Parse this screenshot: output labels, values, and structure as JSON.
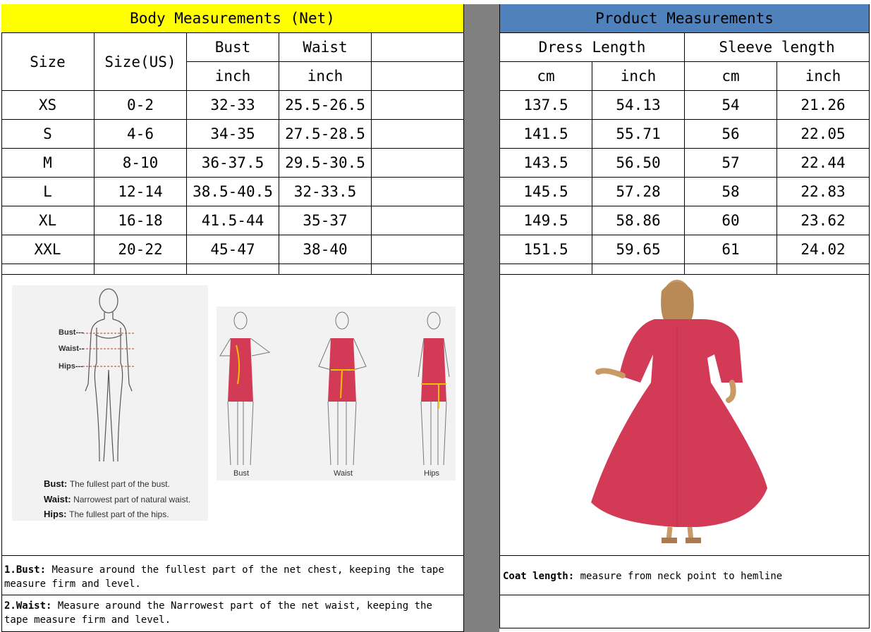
{
  "body_table": {
    "title": "Body Measurements (Net)",
    "col_size": "Size",
    "col_size_us": "Size(US)",
    "col_bust": "Bust",
    "col_waist": "Waist",
    "unit_bust": "inch",
    "unit_waist": "inch",
    "rows": [
      {
        "size": "XS",
        "us": "0-2",
        "bust": "32-33",
        "waist": "25.5-26.5"
      },
      {
        "size": "S",
        "us": "4-6",
        "bust": "34-35",
        "waist": "27.5-28.5"
      },
      {
        "size": "M",
        "us": "8-10",
        "bust": "36-37.5",
        "waist": "29.5-30.5"
      },
      {
        "size": "L",
        "us": "12-14",
        "bust": "38.5-40.5",
        "waist": "32-33.5"
      },
      {
        "size": "XL",
        "us": "16-18",
        "bust": "41.5-44",
        "waist": "35-37"
      },
      {
        "size": "XXL",
        "us": "20-22",
        "bust": "45-47",
        "waist": "38-40"
      }
    ]
  },
  "product_table": {
    "title": "Product Measurements",
    "col_dress_length": "Dress Length",
    "col_sleeve_length": "Sleeve length",
    "units": [
      "cm",
      "inch",
      "cm",
      "inch"
    ],
    "rows": [
      {
        "dl_cm": "137.5",
        "dl_in": "54.13",
        "sl_cm": "54",
        "sl_in": "21.26"
      },
      {
        "dl_cm": "141.5",
        "dl_in": "55.71",
        "sl_cm": "56",
        "sl_in": "22.05"
      },
      {
        "dl_cm": "143.5",
        "dl_in": "56.50",
        "sl_cm": "57",
        "sl_in": "22.44"
      },
      {
        "dl_cm": "145.5",
        "dl_in": "57.28",
        "sl_cm": "58",
        "sl_in": "22.83"
      },
      {
        "dl_cm": "149.5",
        "dl_in": "58.86",
        "sl_cm": "60",
        "sl_in": "23.62"
      },
      {
        "dl_cm": "151.5",
        "dl_in": "59.65",
        "sl_cm": "61",
        "sl_in": "24.02"
      }
    ]
  },
  "figure_diagram": {
    "marker_bust": "Bust---",
    "marker_waist": "Waist--",
    "marker_hips": "Hips---",
    "def_bust_label": "Bust:",
    "def_bust_text": "The fullest part of the bust.",
    "def_waist_label": "Waist:",
    "def_waist_text": "Narrowest part of natural waist.",
    "def_hips_label": "Hips:",
    "def_hips_text": "The fullest part of the hips."
  },
  "dress_diagram": {
    "captions": [
      "Bust",
      "Waist",
      "Hips"
    ]
  },
  "notes": {
    "bust_label": "1.Bust:",
    "bust_text": "Measure around the fullest part of the net chest, keeping the tape  measure firm and level.",
    "waist_label": "2.Waist:",
    "waist_text": "Measure around the Narrowest part of the net waist, keeping the tape  measure firm and level.",
    "coat_label": "Coat length:",
    "coat_text": "measure from neck point to hemline"
  },
  "colors": {
    "body_header": "#ffff00",
    "product_header": "#4f81bd",
    "divider": "#808080",
    "dress": "#d23a55",
    "tape": "#f2c200"
  }
}
